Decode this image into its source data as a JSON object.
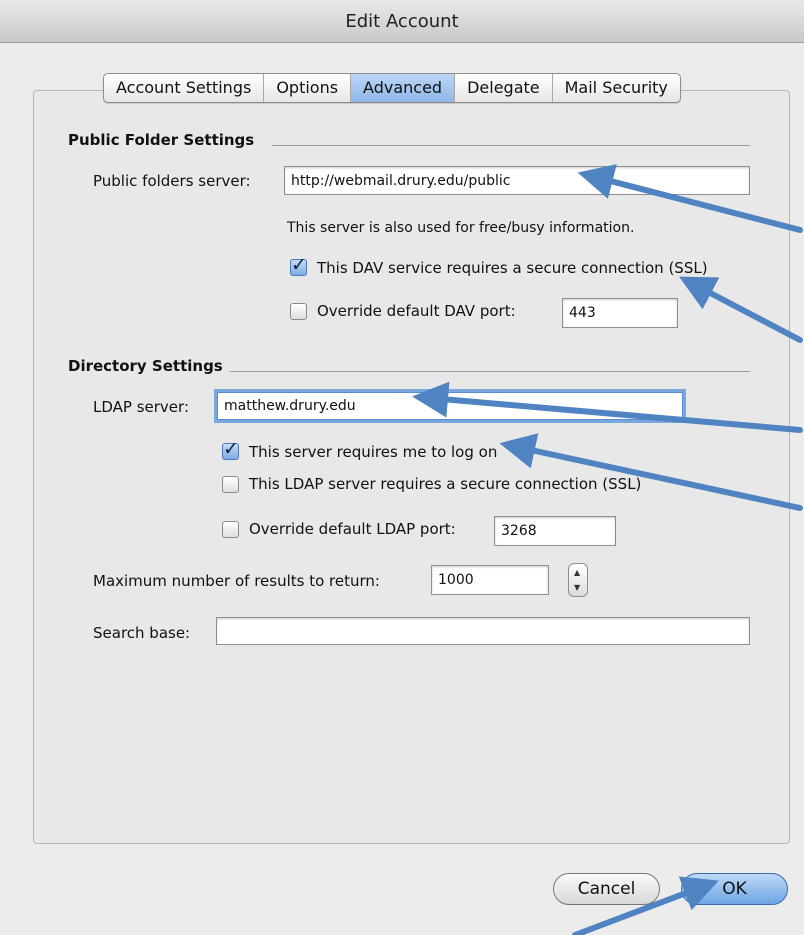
{
  "window": {
    "title": "Edit Account"
  },
  "tabs": [
    "Account Settings",
    "Options",
    "Advanced",
    "Delegate",
    "Mail Security"
  ],
  "active_tab": "Advanced",
  "public_folder": {
    "heading": "Public Folder Settings",
    "server_label": "Public folders server:",
    "server_value": "http://webmail.drury.edu/public",
    "note": "This server is also used for free/busy information.",
    "ssl_label": "This DAV service requires a secure connection (SSL)",
    "ssl_checked": true,
    "override_label": "Override default DAV port:",
    "override_checked": false,
    "port_value": "443"
  },
  "directory": {
    "heading": "Directory Settings",
    "ldap_label": "LDAP server:",
    "ldap_value": "matthew.drury.edu",
    "login_label": "This server requires me to log on",
    "login_checked": true,
    "ssl_label": "This LDAP server requires a secure connection (SSL)",
    "ssl_checked": false,
    "override_label": "Override default LDAP port:",
    "override_checked": false,
    "port_value": "3268",
    "max_label": "Maximum number of results to return:",
    "max_value": "1000",
    "search_label": "Search base:",
    "search_value": ""
  },
  "buttons": {
    "cancel": "Cancel",
    "ok": "OK"
  },
  "colors": {
    "accent": "#6ea4e6",
    "annotation_arrow": "#4f83c1"
  }
}
